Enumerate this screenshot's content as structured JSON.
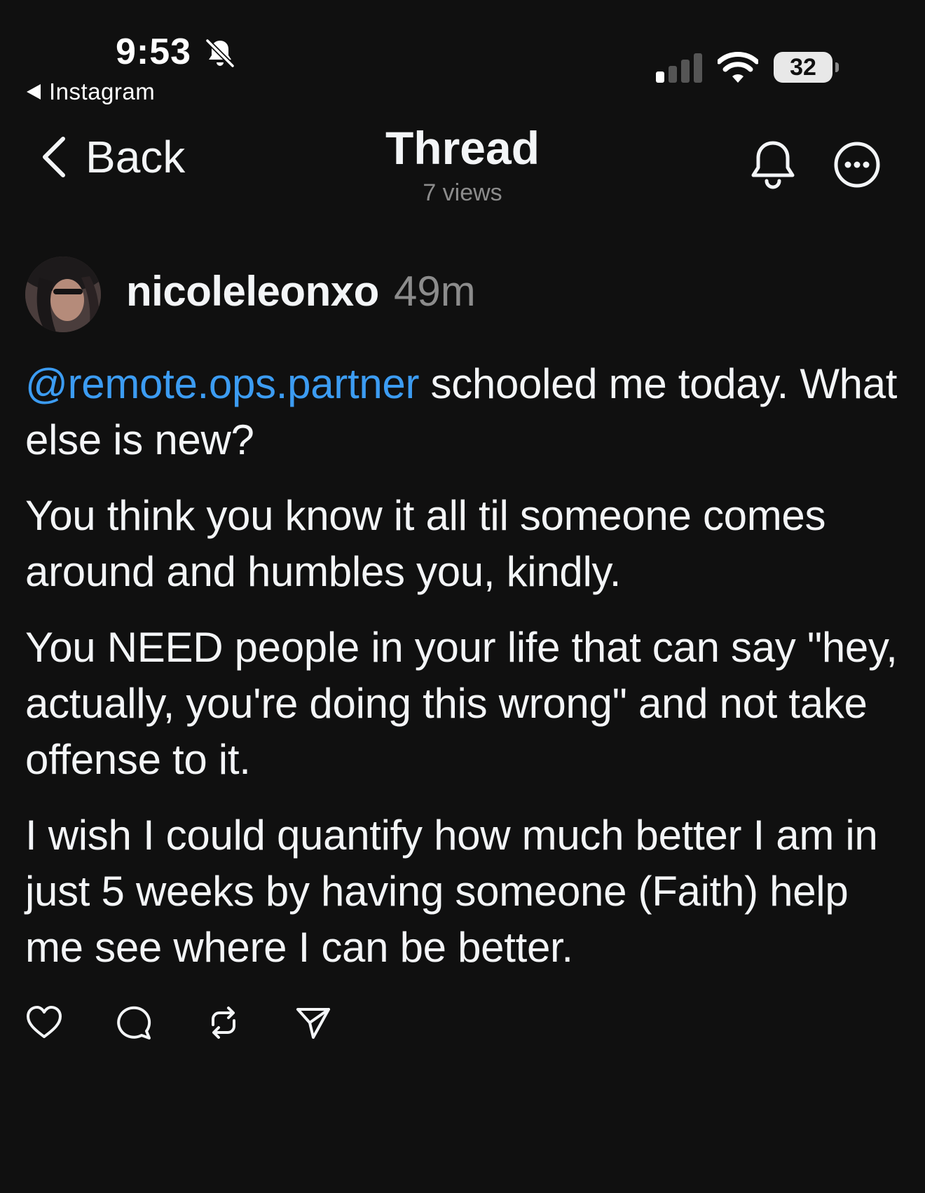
{
  "status_bar": {
    "time": "9:53",
    "back_app_label": "Instagram",
    "battery_level": "32",
    "icons": [
      "bell-slash-icon",
      "cellular-signal-icon",
      "wifi-icon",
      "battery-icon"
    ]
  },
  "nav": {
    "back_label": "Back",
    "title": "Thread",
    "subtitle": "7 views",
    "icons": [
      "chevron-left-icon",
      "bell-icon",
      "more-icon"
    ]
  },
  "post": {
    "username": "nicoleleonxo",
    "timestamp": "49m",
    "mention": "@remote.ops.partner",
    "paragraph1_rest": " schooled me today. What else is new?",
    "paragraph2": "You think you know it all til someone comes around and humbles you, kindly.",
    "paragraph3": "You NEED people in your life that can say \"hey, actually, you're doing this wrong\" and not take offense to it.",
    "paragraph4": "I wish I could quantify how much better I am in just 5 weeks by having someone (Faith) help me see where I can be better."
  },
  "actions": [
    "heart-icon",
    "comment-icon",
    "repost-icon",
    "share-icon"
  ],
  "colors": {
    "background": "#101010",
    "text": "#f3f5f7",
    "muted": "#8c8c8c",
    "mention": "#3c9cf2"
  }
}
